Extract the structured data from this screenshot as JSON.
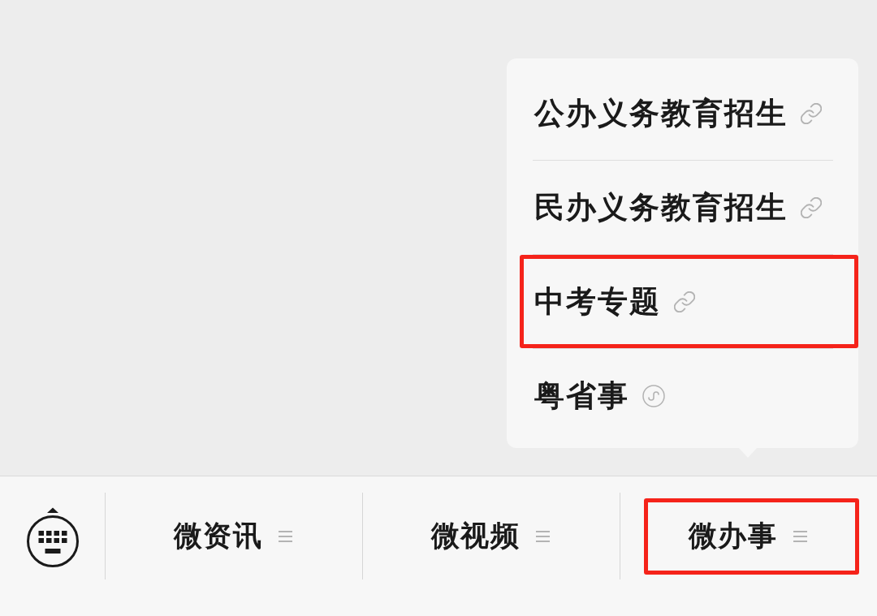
{
  "popup_menu": {
    "items": [
      {
        "label": "公办义务教育招生",
        "kind": "link",
        "highlighted": false
      },
      {
        "label": "民办义务教育招生",
        "kind": "link",
        "highlighted": false
      },
      {
        "label": "中考专题",
        "kind": "link",
        "highlighted": true
      },
      {
        "label": "粤省事",
        "kind": "mini_program",
        "highlighted": false
      }
    ]
  },
  "bottom_bar": {
    "tabs": [
      {
        "label": "微资讯",
        "highlighted": false
      },
      {
        "label": "微视频",
        "highlighted": false
      },
      {
        "label": "微办事",
        "highlighted": true
      }
    ]
  }
}
